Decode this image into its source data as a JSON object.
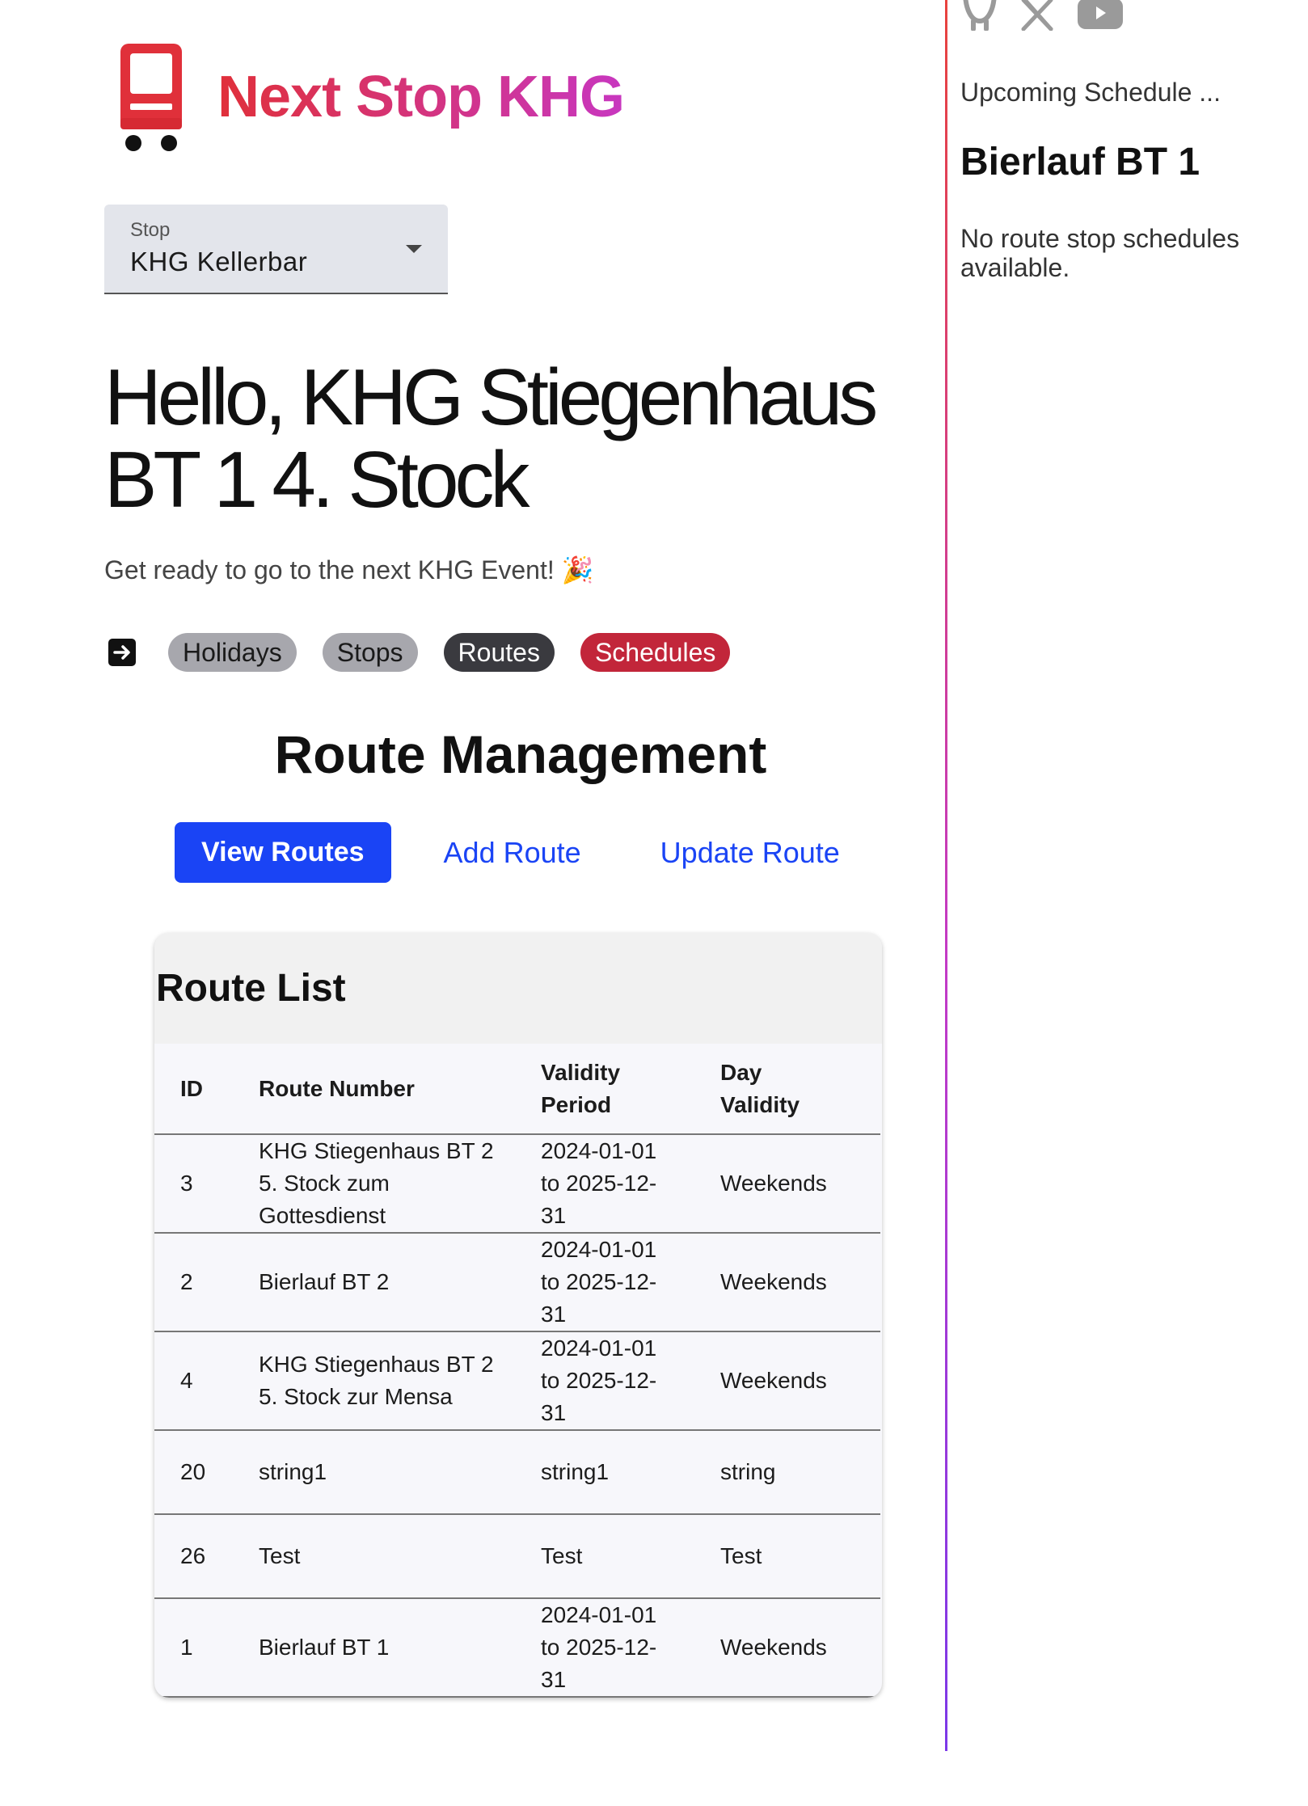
{
  "app": {
    "title": "Next Stop KHG",
    "brand_gradient": [
      "#e0303a",
      "#c837c0"
    ],
    "logo_icon": "bus-icon"
  },
  "stop_select": {
    "label": "Stop",
    "value": "KHG Kellerbar"
  },
  "greeting": "Hello, KHG Stiegenhaus BT 1 4. Stock",
  "tagline": "Get ready to go to the next KHG Event! 🎉",
  "nav": {
    "logout_icon": "logout-icon",
    "chips": [
      {
        "label": "Holidays",
        "color": "#a7a7ad"
      },
      {
        "label": "Stops",
        "color": "#a7a7ad"
      },
      {
        "label": "Routes",
        "color": "#3a3a3f"
      },
      {
        "label": "Schedules",
        "color": "#c2263a"
      }
    ]
  },
  "route_management": {
    "title": "Route Management",
    "tabs": {
      "view": "View Routes",
      "add": "Add Route",
      "update": "Update Route"
    },
    "accent": "#1a44f5"
  },
  "route_list": {
    "title": "Route List",
    "columns": {
      "id": "ID",
      "route_number": "Route Number",
      "validity_line1": "Validity",
      "validity_line2": "Period",
      "day_line1": "Day",
      "day_line2": "Validity"
    },
    "rows": [
      {
        "id": "3",
        "route_lines": [
          "KHG Stiegenhaus BT 2",
          "5. Stock zum",
          "Gottesdienst"
        ],
        "validity_lines": [
          "2024-01-01",
          "to 2025-12-",
          "31"
        ],
        "day": "Weekends"
      },
      {
        "id": "2",
        "route_lines": [
          "Bierlauf BT 2",
          "",
          ""
        ],
        "validity_lines": [
          "2024-01-01",
          "to 2025-12-",
          "31"
        ],
        "day": "Weekends"
      },
      {
        "id": "4",
        "route_lines": [
          "KHG Stiegenhaus BT 2",
          "5. Stock zur Mensa",
          ""
        ],
        "validity_lines": [
          "2024-01-01",
          "to 2025-12-",
          "31"
        ],
        "day": "Weekends"
      },
      {
        "id": "20",
        "route_lines": [
          "string1",
          "",
          ""
        ],
        "validity_lines": [
          "string1",
          "",
          ""
        ],
        "day": "string"
      },
      {
        "id": "26",
        "route_lines": [
          "Test",
          "",
          ""
        ],
        "validity_lines": [
          "Test",
          "",
          ""
        ],
        "day": "Test"
      },
      {
        "id": "1",
        "route_lines": [
          "Bierlauf BT 1",
          "",
          ""
        ],
        "validity_lines": [
          "2024-01-01",
          "to 2025-12-",
          "31"
        ],
        "day": "Weekends"
      }
    ]
  },
  "sidebar": {
    "social_icons": [
      "github-icon",
      "x-icon",
      "youtube-icon"
    ],
    "upcoming_label": "Upcoming Schedule ...",
    "schedule_title": "Bierlauf BT 1",
    "empty_message": "No route stop schedules available."
  }
}
